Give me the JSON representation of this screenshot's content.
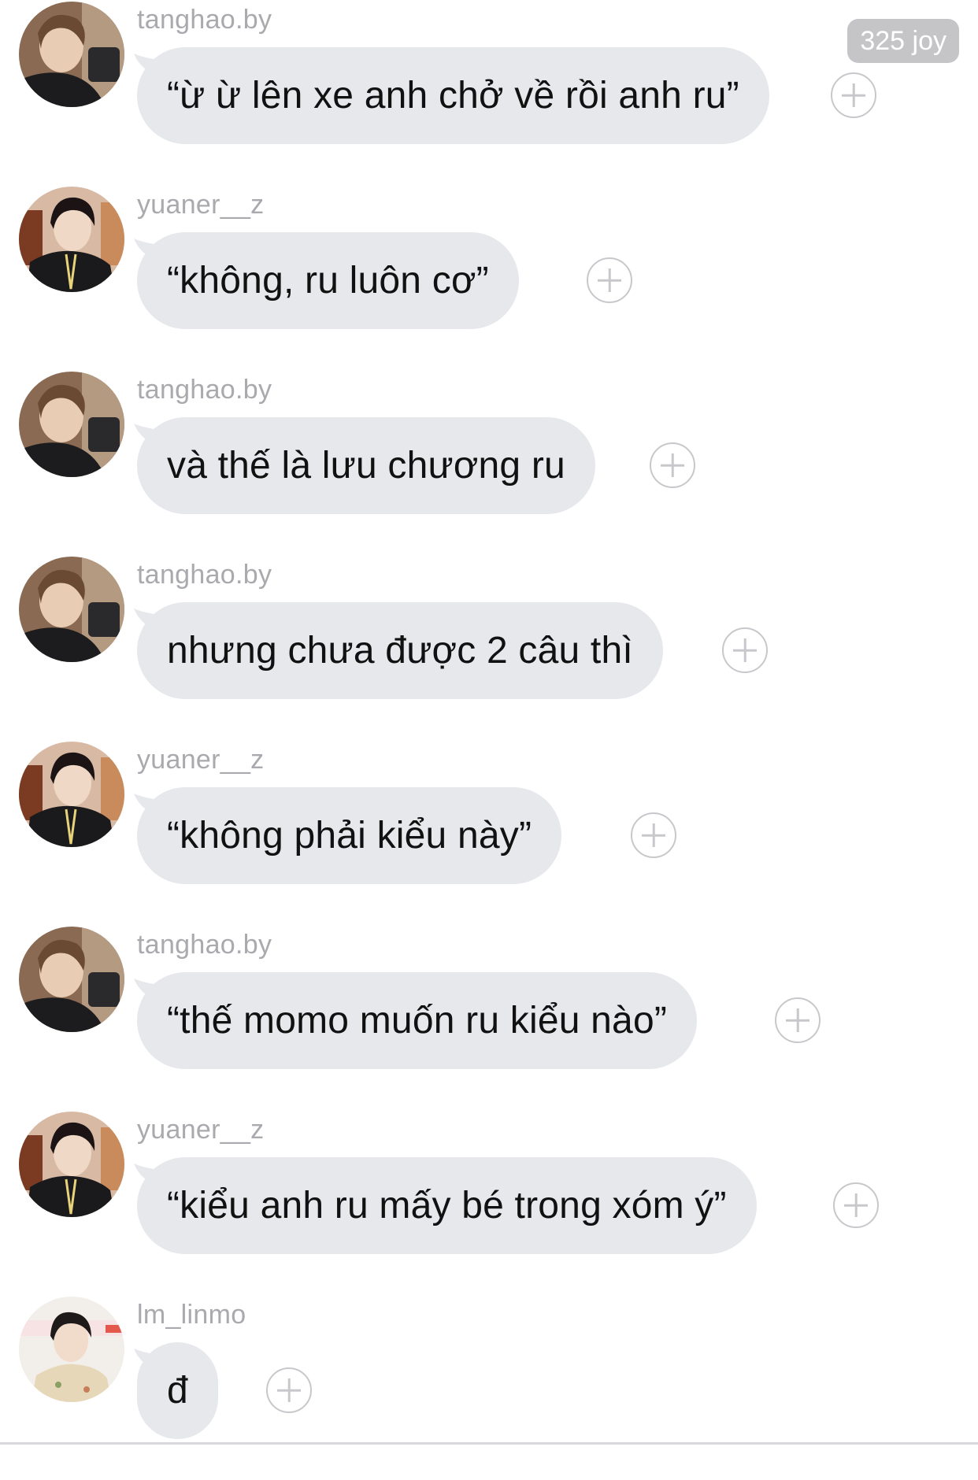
{
  "badge": {
    "text": "325 joy"
  },
  "messages": [
    {
      "username": "tanghao.by",
      "text": "“ừ ừ lên xe anh chở về rồi anh ru”",
      "avatar": "avatar-tanghao"
    },
    {
      "username": "yuaner__z",
      "text": "“không, ru luôn cơ”",
      "avatar": "avatar-yuaner"
    },
    {
      "username": "tanghao.by",
      "text": "và thế là lưu chương ru",
      "avatar": "avatar-tanghao"
    },
    {
      "username": "tanghao.by",
      "text": "nhưng chưa được 2 câu thì",
      "avatar": "avatar-tanghao"
    },
    {
      "username": "yuaner__z",
      "text": "“không phải kiểu này”",
      "avatar": "avatar-yuaner"
    },
    {
      "username": "tanghao.by",
      "text": "“thế momo muốn ru kiểu nào”",
      "avatar": "avatar-tanghao"
    },
    {
      "username": "yuaner__z",
      "text": "“kiểu anh ru mấy bé trong xóm ý”",
      "avatar": "avatar-yuaner"
    },
    {
      "username": "lm_linmo",
      "text": "đ",
      "avatar": "avatar-linmo"
    }
  ],
  "colors": {
    "bubble": "#e6e8ec",
    "username": "#a9a9ae",
    "plus": "#c8c8cc",
    "badge": "#c5c5c8"
  }
}
